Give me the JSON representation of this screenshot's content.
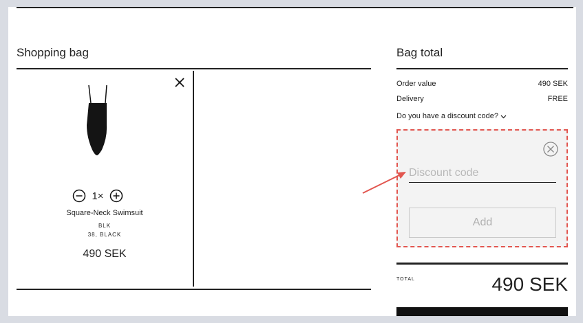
{
  "bag": {
    "title": "Shopping bag",
    "item": {
      "name": "Square-Neck Swimsuit",
      "code": "BLK",
      "variant": "38, BLACK",
      "quantity": "1×",
      "price": "490 SEK"
    }
  },
  "summary": {
    "title": "Bag total",
    "order_value_label": "Order value",
    "order_value": "490 SEK",
    "delivery_label": "Delivery",
    "delivery_value": "FREE",
    "discount_toggle": "Do you have a discount code?",
    "discount": {
      "placeholder": "Discount code",
      "add_label": "Add"
    },
    "total_label": "TOTAL",
    "total_amount": "490 SEK"
  },
  "colors": {
    "highlight": "#e2564f",
    "text": "#222222",
    "background": "#d9dce3"
  },
  "icons": [
    "close-icon",
    "minus-circle-icon",
    "plus-circle-icon",
    "chevron-down-icon",
    "circle-x-icon",
    "arrow-annotation"
  ]
}
